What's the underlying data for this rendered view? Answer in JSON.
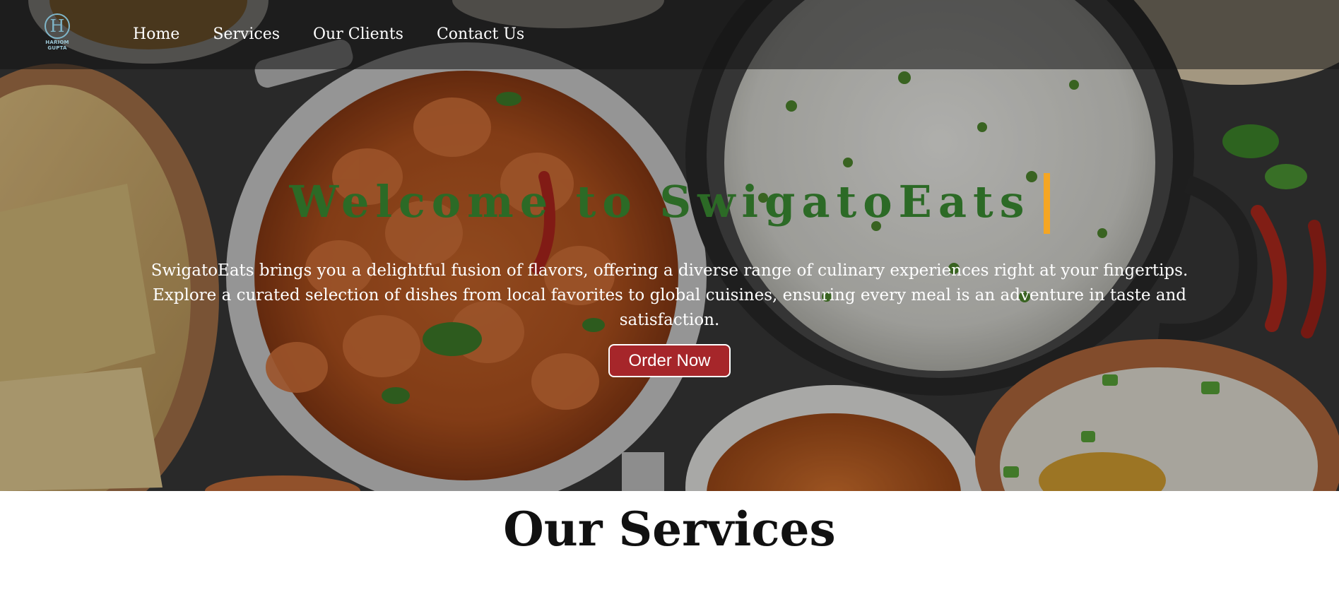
{
  "logo": {
    "text": "HARIOM GUPTA",
    "icon": "h-monogram-logo-icon"
  },
  "nav": {
    "items": [
      {
        "label": "Home"
      },
      {
        "label": "Services"
      },
      {
        "label": "Our Clients"
      },
      {
        "label": "Contact Us"
      }
    ]
  },
  "hero": {
    "title": "Welcome to SwigatoEats",
    "description": "SwigatoEats brings you a delightful fusion of flavors, offering a diverse range of culinary experiences right at your fingertips. Explore a curated selection of dishes from local favorites to global cuisines, ensuring every meal is an adventure in taste and satisfaction.",
    "cta_label": "Order Now",
    "background_image": "food-spread-photo"
  },
  "services": {
    "title": "Our Services"
  },
  "colors": {
    "title_green": "#2c6a26",
    "cursor_orange": "#f5a623",
    "button_red": "#a6262a",
    "navbar_overlay": "rgba(20,20,20,0.55)"
  }
}
